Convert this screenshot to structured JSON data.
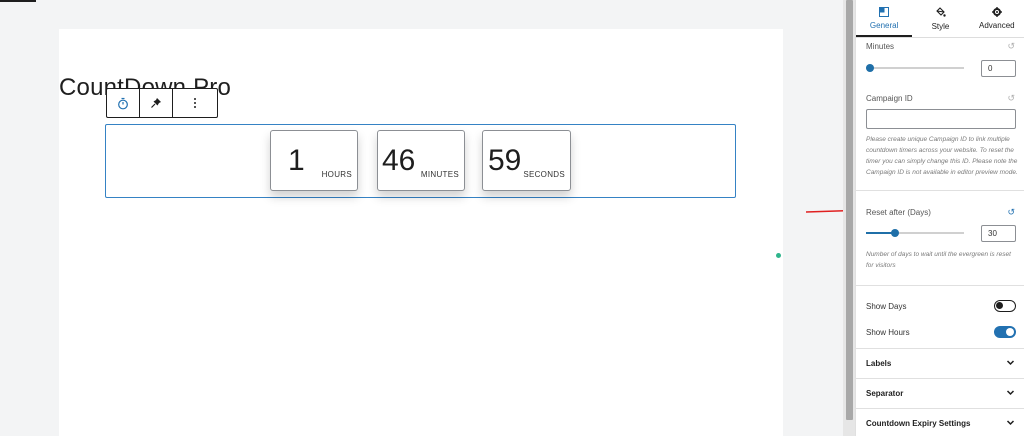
{
  "page": {
    "title": "CountDown Pro"
  },
  "block_toolbar": {
    "items": [
      "timer-icon",
      "pin-icon",
      "more-options-icon"
    ]
  },
  "countdown": {
    "hours": {
      "value": "1",
      "label": "HOURS"
    },
    "minutes": {
      "value": "46",
      "label": "MINUTES"
    },
    "seconds": {
      "value": "59",
      "label": "SECONDS"
    }
  },
  "sidebar": {
    "tabs": [
      {
        "label": "General",
        "icon": "layout-icon",
        "active": true
      },
      {
        "label": "Style",
        "icon": "paint-bucket-icon",
        "active": false
      },
      {
        "label": "Advanced",
        "icon": "gear-icon",
        "active": false
      }
    ],
    "minutes": {
      "label": "Minutes",
      "value": "0",
      "slider_fraction": 0
    },
    "campaign_id": {
      "label": "Campaign ID",
      "value": "",
      "help": "Please create unique Campaign ID to link multiple countdown timers across your website. To reset the timer you can simply change this ID. Please note the Campaign ID is not available in editor preview mode."
    },
    "reset_after": {
      "label": "Reset after (Days)",
      "value": "30",
      "slider_fraction": 0.3,
      "help": "Number of days to wait until the evergreen is reset for visitors"
    },
    "show_days": {
      "label": "Show Days",
      "enabled": false
    },
    "show_hours": {
      "label": "Show Hours",
      "enabled": true
    },
    "sections": [
      {
        "label": "Labels"
      },
      {
        "label": "Separator"
      },
      {
        "label": "Countdown Expiry Settings"
      }
    ]
  },
  "colors": {
    "accent": "#2271b1",
    "slider": "#1f6fa8",
    "arrow": "#e02020",
    "block_border": "#3582c4"
  }
}
